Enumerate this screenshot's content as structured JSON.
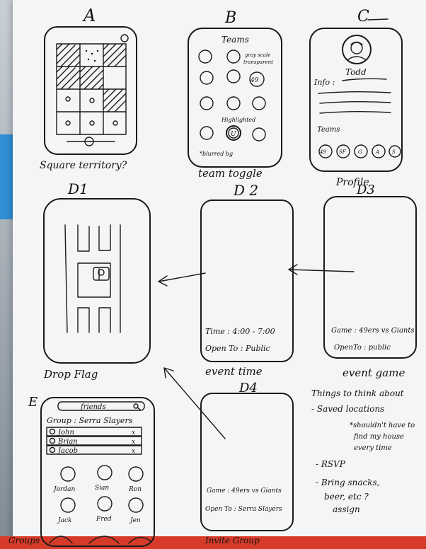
{
  "letters": {
    "a": "A",
    "b": "B",
    "c": "C",
    "d1": "D1",
    "d2": "D 2",
    "d3": "D3",
    "d4": "D4",
    "e": "E"
  },
  "captions": {
    "a": "Square territory?",
    "b": "team toggle",
    "c": "Profile",
    "d1": "Drop  Flag",
    "d2": "event time",
    "d3": "event game",
    "d4": "Invite Group",
    "e": "Groups"
  },
  "phone_b": {
    "title": "Teams",
    "note_grey": "gray scale",
    "note_trans": "transparent",
    "note_highlight": "Highlighted",
    "note_blurred": "*blurred bg",
    "badge_49": "49",
    "badge_u": "U"
  },
  "phone_c": {
    "name": "Todd",
    "info": "Info :",
    "teams": "Teams",
    "logos": [
      "49",
      "SF",
      "G",
      "A",
      "S"
    ]
  },
  "phone_d2": {
    "time": "Time :  4:00 - 7:00",
    "open": "Open To : Public"
  },
  "phone_d3": {
    "game": "Game : 49ers vs Giants",
    "open": "OpenTo : public"
  },
  "phone_d4": {
    "game": "Game : 49ers vs Giants",
    "open": "Open To : Serra Slayers"
  },
  "phone_e": {
    "search": "friends",
    "group": "Group : Serra Slayers",
    "members": [
      "John",
      "Brian",
      "Jacob"
    ],
    "friends": [
      "Jordan",
      "Sian",
      "Ron",
      "Jack",
      "Fred",
      "Jen"
    ]
  },
  "notes": {
    "heading": "Things to think about",
    "l1": "- Saved locations",
    "l2": "*shouldn't have to",
    "l3": "find my house",
    "l4": "every time",
    "l5": "- RSVP",
    "l6": "- Bring snacks,",
    "l7": "beer, etc ?",
    "l8": "assign"
  }
}
